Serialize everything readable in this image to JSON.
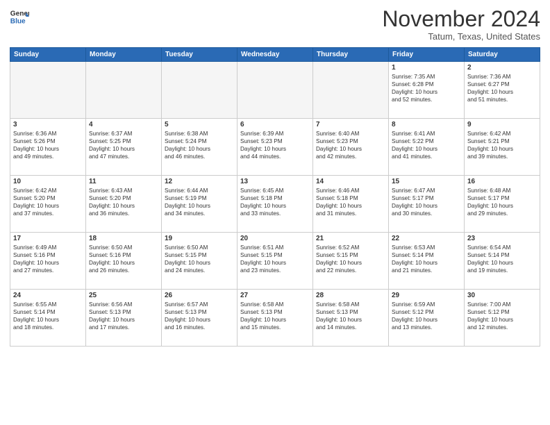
{
  "header": {
    "logo_line1": "General",
    "logo_line2": "Blue",
    "month": "November 2024",
    "location": "Tatum, Texas, United States"
  },
  "days_of_week": [
    "Sunday",
    "Monday",
    "Tuesday",
    "Wednesday",
    "Thursday",
    "Friday",
    "Saturday"
  ],
  "weeks": [
    [
      {
        "day": "",
        "info": ""
      },
      {
        "day": "",
        "info": ""
      },
      {
        "day": "",
        "info": ""
      },
      {
        "day": "",
        "info": ""
      },
      {
        "day": "",
        "info": ""
      },
      {
        "day": "1",
        "info": "Sunrise: 7:35 AM\nSunset: 6:28 PM\nDaylight: 10 hours\nand 52 minutes."
      },
      {
        "day": "2",
        "info": "Sunrise: 7:36 AM\nSunset: 6:27 PM\nDaylight: 10 hours\nand 51 minutes."
      }
    ],
    [
      {
        "day": "3",
        "info": "Sunrise: 6:36 AM\nSunset: 5:26 PM\nDaylight: 10 hours\nand 49 minutes."
      },
      {
        "day": "4",
        "info": "Sunrise: 6:37 AM\nSunset: 5:25 PM\nDaylight: 10 hours\nand 47 minutes."
      },
      {
        "day": "5",
        "info": "Sunrise: 6:38 AM\nSunset: 5:24 PM\nDaylight: 10 hours\nand 46 minutes."
      },
      {
        "day": "6",
        "info": "Sunrise: 6:39 AM\nSunset: 5:23 PM\nDaylight: 10 hours\nand 44 minutes."
      },
      {
        "day": "7",
        "info": "Sunrise: 6:40 AM\nSunset: 5:23 PM\nDaylight: 10 hours\nand 42 minutes."
      },
      {
        "day": "8",
        "info": "Sunrise: 6:41 AM\nSunset: 5:22 PM\nDaylight: 10 hours\nand 41 minutes."
      },
      {
        "day": "9",
        "info": "Sunrise: 6:42 AM\nSunset: 5:21 PM\nDaylight: 10 hours\nand 39 minutes."
      }
    ],
    [
      {
        "day": "10",
        "info": "Sunrise: 6:42 AM\nSunset: 5:20 PM\nDaylight: 10 hours\nand 37 minutes."
      },
      {
        "day": "11",
        "info": "Sunrise: 6:43 AM\nSunset: 5:20 PM\nDaylight: 10 hours\nand 36 minutes."
      },
      {
        "day": "12",
        "info": "Sunrise: 6:44 AM\nSunset: 5:19 PM\nDaylight: 10 hours\nand 34 minutes."
      },
      {
        "day": "13",
        "info": "Sunrise: 6:45 AM\nSunset: 5:18 PM\nDaylight: 10 hours\nand 33 minutes."
      },
      {
        "day": "14",
        "info": "Sunrise: 6:46 AM\nSunset: 5:18 PM\nDaylight: 10 hours\nand 31 minutes."
      },
      {
        "day": "15",
        "info": "Sunrise: 6:47 AM\nSunset: 5:17 PM\nDaylight: 10 hours\nand 30 minutes."
      },
      {
        "day": "16",
        "info": "Sunrise: 6:48 AM\nSunset: 5:17 PM\nDaylight: 10 hours\nand 29 minutes."
      }
    ],
    [
      {
        "day": "17",
        "info": "Sunrise: 6:49 AM\nSunset: 5:16 PM\nDaylight: 10 hours\nand 27 minutes."
      },
      {
        "day": "18",
        "info": "Sunrise: 6:50 AM\nSunset: 5:16 PM\nDaylight: 10 hours\nand 26 minutes."
      },
      {
        "day": "19",
        "info": "Sunrise: 6:50 AM\nSunset: 5:15 PM\nDaylight: 10 hours\nand 24 minutes."
      },
      {
        "day": "20",
        "info": "Sunrise: 6:51 AM\nSunset: 5:15 PM\nDaylight: 10 hours\nand 23 minutes."
      },
      {
        "day": "21",
        "info": "Sunrise: 6:52 AM\nSunset: 5:15 PM\nDaylight: 10 hours\nand 22 minutes."
      },
      {
        "day": "22",
        "info": "Sunrise: 6:53 AM\nSunset: 5:14 PM\nDaylight: 10 hours\nand 21 minutes."
      },
      {
        "day": "23",
        "info": "Sunrise: 6:54 AM\nSunset: 5:14 PM\nDaylight: 10 hours\nand 19 minutes."
      }
    ],
    [
      {
        "day": "24",
        "info": "Sunrise: 6:55 AM\nSunset: 5:14 PM\nDaylight: 10 hours\nand 18 minutes."
      },
      {
        "day": "25",
        "info": "Sunrise: 6:56 AM\nSunset: 5:13 PM\nDaylight: 10 hours\nand 17 minutes."
      },
      {
        "day": "26",
        "info": "Sunrise: 6:57 AM\nSunset: 5:13 PM\nDaylight: 10 hours\nand 16 minutes."
      },
      {
        "day": "27",
        "info": "Sunrise: 6:58 AM\nSunset: 5:13 PM\nDaylight: 10 hours\nand 15 minutes."
      },
      {
        "day": "28",
        "info": "Sunrise: 6:58 AM\nSunset: 5:13 PM\nDaylight: 10 hours\nand 14 minutes."
      },
      {
        "day": "29",
        "info": "Sunrise: 6:59 AM\nSunset: 5:12 PM\nDaylight: 10 hours\nand 13 minutes."
      },
      {
        "day": "30",
        "info": "Sunrise: 7:00 AM\nSunset: 5:12 PM\nDaylight: 10 hours\nand 12 minutes."
      }
    ]
  ]
}
